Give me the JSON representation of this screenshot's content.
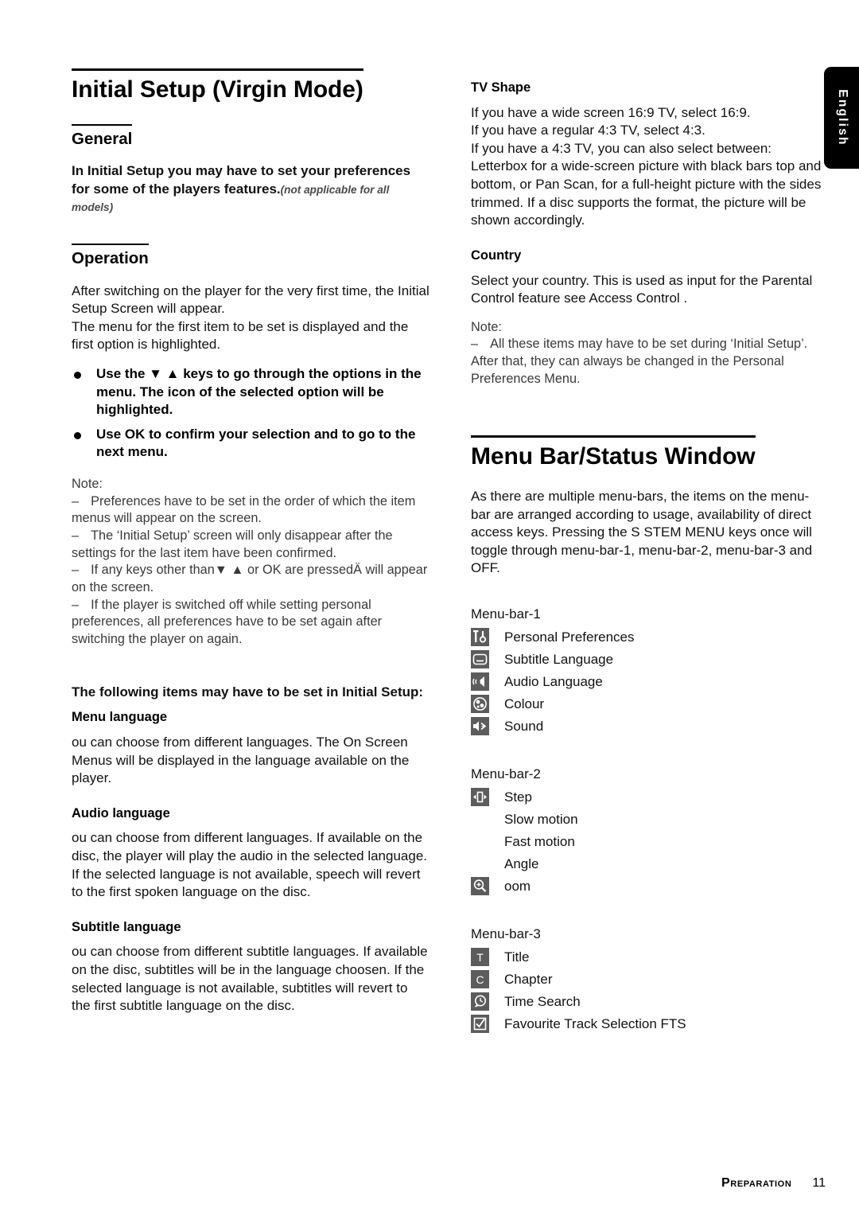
{
  "side_tab": {
    "label": "English"
  },
  "left": {
    "title": "Initial Setup (Virgin Mode)",
    "general": {
      "heading": "General",
      "para_bold": "In Initial Setup you may have to set your preferences for some of the players features.",
      "para_italic": "(not applicable for all models)"
    },
    "operation": {
      "heading": "Operation",
      "para1": "After switching on the player for the very first time, the Initial Setup Screen will appear.",
      "para2": "The menu for the first item to be set is displayed and the first option is highlighted.",
      "bullets": [
        "Use the ▼ ▲ keys to go through the options in the menu. The icon of the selected option will be highlighted.",
        "Use OK to confirm your selection and to go to the next menu."
      ],
      "note_label": "Note:",
      "notes": [
        "Preferences have to be set in the order of which the item menus will appear on the screen.",
        "The ‘Initial Setup’ screen will only disappear after the settings for the last item have been confirmed.",
        "If any keys other than▼ ▲ or OK are pressedÄ will appear on the screen.",
        "If the player is switched off while setting personal preferences, all preferences have to be set again after switching the player on again."
      ]
    },
    "items_intro": "The following items may have to be set in Initial Setup:",
    "sections": [
      {
        "heading": "Menu language",
        "body": " ou can choose from different languages. The On Screen Menus will be displayed in the language available on the player."
      },
      {
        "heading": "Audio language",
        "body": " ou can choose from different languages. If available on the disc, the player will play the audio in the selected language. If the selected language is not available, speech will revert to the first spoken language on the disc."
      },
      {
        "heading": "Subtitle language",
        "body": " ou can choose from different subtitle languages. If available on the disc, subtitles will be in the language choosen. If the selected language is not available, subtitles will revert to the first subtitle language on the disc."
      }
    ]
  },
  "right": {
    "tv_shape": {
      "heading": "TV Shape",
      "lines": [
        "If you have a wide screen  16:9  TV, select 16:9.",
        "If you have a regular  4:3  TV, select 4:3.",
        "If you have a 4:3 TV, you can also select between:",
        "Letterbox for a wide-screen picture with black bars top and bottom, or Pan Scan, for a full-height picture with the sides trimmed. If a disc supports the format, the picture will be shown accordingly."
      ]
    },
    "country": {
      "heading": "Country",
      "body": "Select your country. This is used as input for the Parental Control feature  see Access Control .",
      "note_label": "Note:",
      "notes": [
        "All these items may have to be set during ‘Initial Setup’. After that, they can always be changed in the Personal Preferences Menu."
      ]
    },
    "menu_bar": {
      "title": "Menu Bar/Status Window",
      "intro": "As there are multiple menu-bars, the items on the menu-bar are arranged according to usage, availability of direct access keys. Pressing the S  STEM MENU keys once will toggle through menu-bar-1, menu-bar-2, menu-bar-3 and OFF.",
      "bars": [
        {
          "label": "Menu-bar-1",
          "items": [
            {
              "icon": "tools-icon",
              "label": "Personal Preferences"
            },
            {
              "icon": "subtitle-icon",
              "label": "Subtitle Language"
            },
            {
              "icon": "audio-icon",
              "label": "Audio Language"
            },
            {
              "icon": "colour-icon",
              "label": "Colour"
            },
            {
              "icon": "sound-icon",
              "label": "Sound"
            }
          ]
        },
        {
          "label": "Menu-bar-2",
          "items": [
            {
              "icon": "step-icon",
              "label": "Step"
            },
            {
              "icon": "none",
              "label": "Slow motion"
            },
            {
              "icon": "none",
              "label": "Fast motion"
            },
            {
              "icon": "none",
              "label": "Angle"
            },
            {
              "icon": "zoom-icon",
              "label": " oom"
            }
          ]
        },
        {
          "label": "Menu-bar-3",
          "items": [
            {
              "icon": "title-icon",
              "label": "Title"
            },
            {
              "icon": "chapter-icon",
              "label": "Chapter"
            },
            {
              "icon": "time-search-icon",
              "label": "Time Search"
            },
            {
              "icon": "fts-icon",
              "label": "Favourite Track Selection  FTS"
            }
          ]
        }
      ]
    }
  },
  "footer": {
    "chapter": "Preparation",
    "page": "11"
  }
}
